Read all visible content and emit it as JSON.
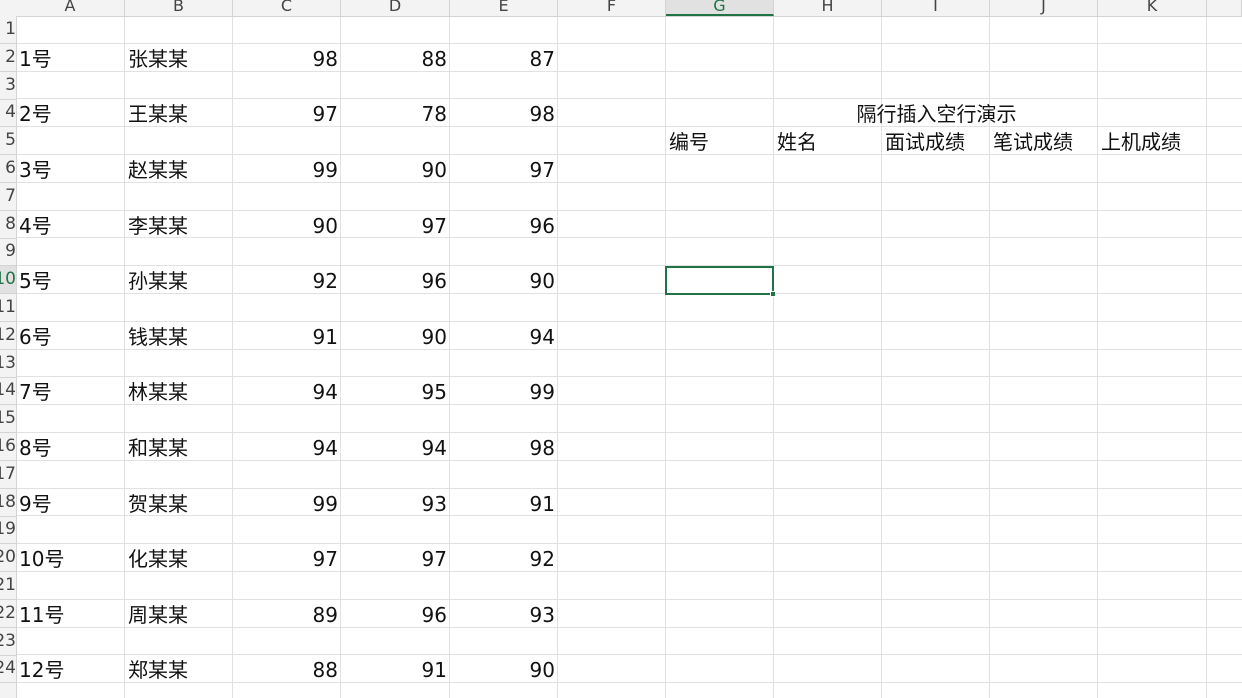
{
  "columns": [
    "A",
    "B",
    "C",
    "D",
    "E",
    "F",
    "G",
    "H",
    "I",
    "J",
    "K"
  ],
  "selected_column": "G",
  "row_headers": [
    "1",
    "2",
    "3",
    "4",
    "5",
    "6",
    "7",
    "8",
    "9",
    "10",
    "11",
    "12",
    "13",
    "14",
    "15",
    "16",
    "17",
    "18",
    "19",
    "20",
    "21",
    "22",
    "23",
    "24"
  ],
  "selected_row": "10",
  "records": [
    {
      "id": "1号",
      "name": "张某某",
      "c": "98",
      "d": "88",
      "e": "87"
    },
    {
      "id": "2号",
      "name": "王某某",
      "c": "97",
      "d": "78",
      "e": "98"
    },
    {
      "id": "3号",
      "name": "赵某某",
      "c": "99",
      "d": "90",
      "e": "97"
    },
    {
      "id": "4号",
      "name": "李某某",
      "c": "90",
      "d": "97",
      "e": "96"
    },
    {
      "id": "5号",
      "name": "孙某某",
      "c": "92",
      "d": "96",
      "e": "90"
    },
    {
      "id": "6号",
      "name": "钱某某",
      "c": "91",
      "d": "90",
      "e": "94"
    },
    {
      "id": "7号",
      "name": "林某某",
      "c": "94",
      "d": "95",
      "e": "99"
    },
    {
      "id": "8号",
      "name": "和某某",
      "c": "94",
      "d": "94",
      "e": "98"
    },
    {
      "id": "9号",
      "name": "贺某某",
      "c": "99",
      "d": "93",
      "e": "91"
    },
    {
      "id": "10号",
      "name": "化某某",
      "c": "97",
      "d": "97",
      "e": "92"
    },
    {
      "id": "11号",
      "name": "周某某",
      "c": "89",
      "d": "96",
      "e": "93"
    },
    {
      "id": "12号",
      "name": "郑某某",
      "c": "88",
      "d": "91",
      "e": "90"
    }
  ],
  "demo": {
    "title": "隔行插入空行演示",
    "headers": [
      "编号",
      "姓名",
      "面试成绩",
      "笔试成绩",
      "上机成绩"
    ]
  },
  "colors": {
    "selection": "#217346",
    "gridline": "#e1e1e1",
    "header_bg": "#f3f3f3"
  }
}
